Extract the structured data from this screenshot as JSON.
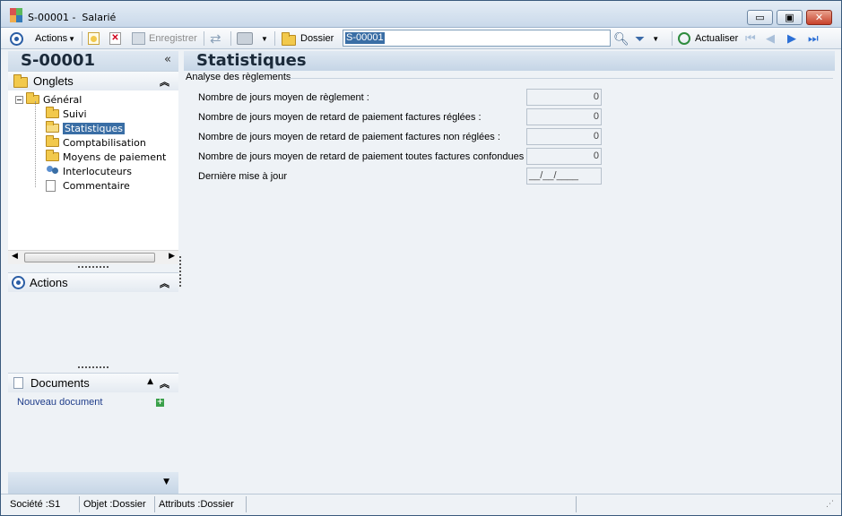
{
  "window": {
    "title_code": "S-00001 -",
    "title_name": "Salarié",
    "minimize_label": "▭",
    "maximize_label": "▣",
    "close_label": "✕"
  },
  "toolbar": {
    "actions_label": "Actions",
    "save_label": "Enregistrer",
    "dossier_label": "Dossier",
    "search_value": "S-00001",
    "refresh_label": "Actualiser"
  },
  "left": {
    "code": "S-00001",
    "collapse_glyph": "«",
    "tabs_title": "Onglets",
    "tree": [
      {
        "label": "Général",
        "icon": "folder-icon"
      },
      {
        "label": "Suivi",
        "icon": "folder-icon"
      },
      {
        "label": "Statistiques",
        "icon": "folder-open-icon",
        "selected": true
      },
      {
        "label": "Comptabilisation",
        "icon": "folder-icon"
      },
      {
        "label": "Moyens de paiement",
        "icon": "folder-icon"
      },
      {
        "label": "Interlocuteurs",
        "icon": "people-icon"
      },
      {
        "label": "Commentaire",
        "icon": "document-icon"
      }
    ],
    "actions_title": "Actions",
    "documents_title": "Documents",
    "new_document_label": "Nouveau document"
  },
  "main": {
    "title": "Statistiques",
    "group_title": "Analyse des règlements",
    "fields": [
      {
        "label": "Nombre de jours moyen de règlement :",
        "value": "0"
      },
      {
        "label": "Nombre de jours moyen de retard de paiement factures réglées :",
        "value": "0"
      },
      {
        "label": "Nombre de jours moyen de retard de paiement factures non réglées :",
        "value": "0"
      },
      {
        "label": "Nombre de jours moyen de retard de paiement toutes factures confondues :",
        "value": "0"
      },
      {
        "label": "Dernière mise à jour",
        "value": "__/__/____"
      }
    ]
  },
  "status": {
    "societe": "Société :S1",
    "objet": "Objet :Dossier",
    "attributs": "Attributs :Dossier"
  }
}
